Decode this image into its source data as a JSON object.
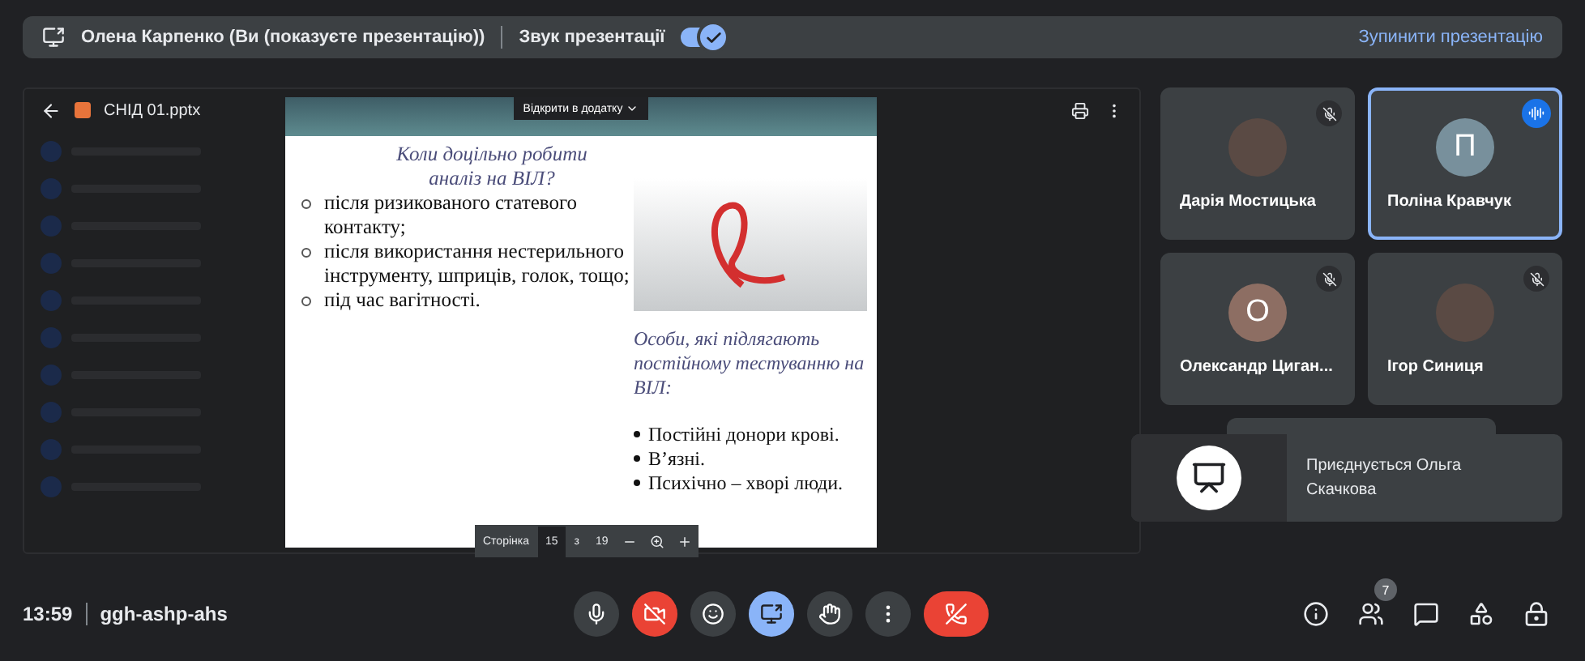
{
  "presenting_bar": {
    "presenter": "Олена Карпенко (Ви (показуєте презентацію))",
    "sound_label": "Звук презентації",
    "sound_on": true,
    "stop_link": "Зупинити презентацію"
  },
  "viewer": {
    "file_name": "СНІД 01.pptx",
    "open_in_app": "Відкрити в додатку",
    "slide": {
      "title": "Коли доцільно робити аналіз на ВІЛ?",
      "bullets": [
        "після ризикованого статевого контакту;",
        " після використання нестерильного інструменту, шприців, голок, тощо;",
        "під час вагітності."
      ],
      "subtitle": "Особи, які підлягають постійному тестуванню на ВІЛ:",
      "list": [
        "Постійні донори крові.",
        "В’язні.",
        "Психічно – хворі люди."
      ]
    },
    "pager": {
      "label": "Сторінка",
      "page": "15",
      "of": "з",
      "total": "19"
    }
  },
  "participants": [
    {
      "name": "Дарія Мостицька",
      "kind": "photo",
      "muted": true,
      "speaking": false
    },
    {
      "name": "Поліна Кравчук",
      "kind": "letter",
      "initial": "П",
      "color": "#78909c",
      "muted": false,
      "speaking": true
    },
    {
      "name": "Олександр Циган...",
      "kind": "letter",
      "initial": "О",
      "color": "#8d6e63",
      "muted": true,
      "speaking": false
    },
    {
      "name": "Ігор Синиця",
      "kind": "photo",
      "muted": true,
      "speaking": false
    }
  ],
  "join_toast": {
    "text": "Приєднується Ольга Скачкова"
  },
  "bottom_bar": {
    "time": "13:59",
    "meeting_code": "ggh-ashp-ahs",
    "participant_count": "7",
    "mic_on": true,
    "camera_on": false,
    "presenting": true
  }
}
